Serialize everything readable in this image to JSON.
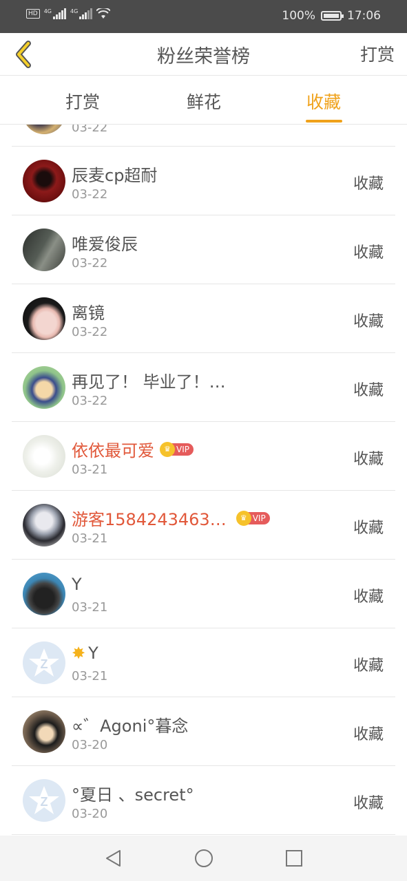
{
  "status_bar": {
    "hd": "HD",
    "net1": "4G",
    "net2": "4G",
    "battery_percent": "100%",
    "time": "17:06"
  },
  "header": {
    "title": "粉丝荣誉榜",
    "action_label": "打赏"
  },
  "tabs": [
    {
      "label": "打赏",
      "active": false
    },
    {
      "label": "鲜花",
      "active": false
    },
    {
      "label": "收藏",
      "active": true
    }
  ],
  "accent_color": "#f0a21b",
  "vip_name_color": "#e1583a",
  "partial_row": {
    "date": "03-22"
  },
  "rows": [
    {
      "name": "辰麦cp超耐",
      "date": "03-22",
      "action": "收藏",
      "vip": false
    },
    {
      "name": "唯爱俊辰",
      "date": "03-22",
      "action": "收藏",
      "vip": false
    },
    {
      "name": "离镜",
      "date": "03-22",
      "action": "收藏",
      "vip": false
    },
    {
      "name": "再见了！ 毕业了！…",
      "date": "03-22",
      "action": "收藏",
      "vip": false
    },
    {
      "name": "依依最可爱",
      "date": "03-21",
      "action": "收藏",
      "vip": true,
      "vip_label": "VIP"
    },
    {
      "name": "游客1584243463…",
      "date": "03-21",
      "action": "收藏",
      "vip": true,
      "vip_label": "VIP"
    },
    {
      "name": "Y",
      "date": "03-21",
      "action": "收藏",
      "vip": false
    },
    {
      "name": "Y",
      "date": "03-21",
      "action": "收藏",
      "vip": false,
      "prefix_icon": "sun-icon"
    },
    {
      "name": "∝゛Agoni°暮念",
      "date": "03-20",
      "action": "收藏",
      "vip": false
    },
    {
      "name": "°夏日 、secret°",
      "date": "03-20",
      "action": "收藏",
      "vip": false
    }
  ]
}
